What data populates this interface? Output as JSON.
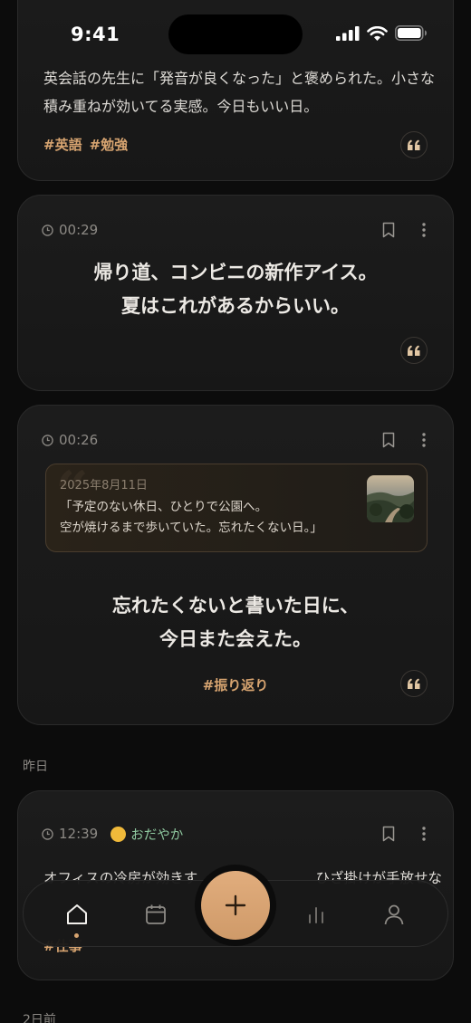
{
  "status_bar": {
    "time": "9:41"
  },
  "feed": {
    "card1": {
      "text_line1": "英会話の先生に「発音が良くなった」と褒められた。小さな",
      "text_line2": "積み重ねが効いてる実感。今日もいい日。",
      "tags": [
        "#英語",
        "#勉強"
      ]
    },
    "card2": {
      "time": "00:29",
      "line1": "帰り道、コンビニの新作アイス。",
      "line2": "夏はこれがあるからいい。"
    },
    "card3": {
      "time": "00:26",
      "memory": {
        "date": "2025年8月11日",
        "line1": "「予定のない休日、ひとりで公園へ。",
        "line2": "空が焼けるまで歩いていた。忘れたくない日。」"
      },
      "line1": "忘れたくないと書いた日に、",
      "line2": "今日また会えた。",
      "tag": "#振り返り"
    },
    "section_yesterday": "昨日",
    "card4": {
      "time": "12:39",
      "mood": "おだやか",
      "text_start": "オフィスの冷房が効きす",
      "text_end": "ひざ掛けが手放せな",
      "tag_partial": "#仕事"
    },
    "section_two_days": "2日前"
  },
  "nav": {
    "items": [
      "home-icon",
      "calendar-icon",
      "add-icon",
      "stats-icon",
      "profile-icon"
    ],
    "active": "home"
  },
  "colors": {
    "accent": "#d7a470",
    "background": "#0c0c0c",
    "card": "#1a1a1a",
    "mood": "#8fc9a0"
  }
}
